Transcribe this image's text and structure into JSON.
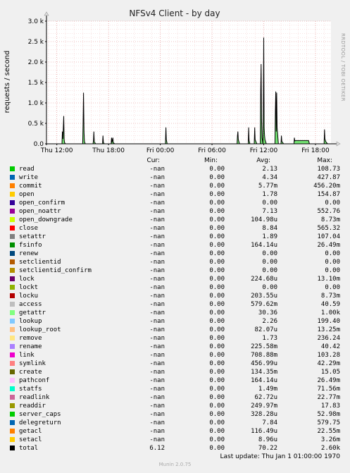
{
  "title": "NFSv4 Client - by day",
  "vertical_label": "requests / second",
  "right_text": "RRDTOOL / TOBI OETIKER",
  "footer": "Munin 2.0.75",
  "last_update": "Last update: Thu Jan  1 01:00:00 1970",
  "legend_headers": {
    "cur": "Cur:",
    "min": "Min:",
    "avg": "Avg:",
    "max": "Max:"
  },
  "legend": [
    {
      "name": "read",
      "color": "#00cc00",
      "cur": "-nan",
      "min": "0.00",
      "avg": "2.13",
      "max": "108.73"
    },
    {
      "name": "write",
      "color": "#0066b3",
      "cur": "-nan",
      "min": "0.00",
      "avg": "4.34",
      "max": "427.87"
    },
    {
      "name": "commit",
      "color": "#ff8000",
      "cur": "-nan",
      "min": "0.00",
      "avg": "5.77m",
      "max": "456.20m"
    },
    {
      "name": "open",
      "color": "#ffcc00",
      "cur": "-nan",
      "min": "0.00",
      "avg": "1.78",
      "max": "154.87"
    },
    {
      "name": "open_confirm",
      "color": "#330099",
      "cur": "-nan",
      "min": "0.00",
      "avg": "0.00",
      "max": "0.00"
    },
    {
      "name": "open_noattr",
      "color": "#990099",
      "cur": "-nan",
      "min": "0.00",
      "avg": "7.13",
      "max": "552.76"
    },
    {
      "name": "open_downgrade",
      "color": "#ccff00",
      "cur": "-nan",
      "min": "0.00",
      "avg": "104.98u",
      "max": "8.73m"
    },
    {
      "name": "close",
      "color": "#ff0000",
      "cur": "-nan",
      "min": "0.00",
      "avg": "8.84",
      "max": "565.32"
    },
    {
      "name": "setattr",
      "color": "#808080",
      "cur": "-nan",
      "min": "0.00",
      "avg": "1.89",
      "max": "107.04"
    },
    {
      "name": "fsinfo",
      "color": "#008f00",
      "cur": "-nan",
      "min": "0.00",
      "avg": "164.14u",
      "max": "26.49m"
    },
    {
      "name": "renew",
      "color": "#00487d",
      "cur": "-nan",
      "min": "0.00",
      "avg": "0.00",
      "max": "0.00"
    },
    {
      "name": "setclientid",
      "color": "#b35a00",
      "cur": "-nan",
      "min": "0.00",
      "avg": "0.00",
      "max": "0.00"
    },
    {
      "name": "setclientid_confirm",
      "color": "#b38f00",
      "cur": "-nan",
      "min": "0.00",
      "avg": "0.00",
      "max": "0.00"
    },
    {
      "name": "lock",
      "color": "#6b006b",
      "cur": "-nan",
      "min": "0.00",
      "avg": "224.68u",
      "max": "13.10m"
    },
    {
      "name": "lockt",
      "color": "#8fb300",
      "cur": "-nan",
      "min": "0.00",
      "avg": "0.00",
      "max": "0.00"
    },
    {
      "name": "locku",
      "color": "#b30000",
      "cur": "-nan",
      "min": "0.00",
      "avg": "203.55u",
      "max": "8.73m"
    },
    {
      "name": "access",
      "color": "#bebebe",
      "cur": "-nan",
      "min": "0.00",
      "avg": "579.62m",
      "max": "40.59"
    },
    {
      "name": "getattr",
      "color": "#80ff80",
      "cur": "-nan",
      "min": "0.00",
      "avg": "30.36",
      "max": "1.00k"
    },
    {
      "name": "lookup",
      "color": "#80c9ff",
      "cur": "-nan",
      "min": "0.00",
      "avg": "2.26",
      "max": "199.40"
    },
    {
      "name": "lookup_root",
      "color": "#ffc080",
      "cur": "-nan",
      "min": "0.00",
      "avg": "82.07u",
      "max": "13.25m"
    },
    {
      "name": "remove",
      "color": "#ffe680",
      "cur": "-nan",
      "min": "0.00",
      "avg": "1.73",
      "max": "236.24"
    },
    {
      "name": "rename",
      "color": "#aa80ff",
      "cur": "-nan",
      "min": "0.00",
      "avg": "225.58m",
      "max": "40.42"
    },
    {
      "name": "link",
      "color": "#ee00cc",
      "cur": "-nan",
      "min": "0.00",
      "avg": "708.88m",
      "max": "103.28"
    },
    {
      "name": "symlink",
      "color": "#ff8080",
      "cur": "-nan",
      "min": "0.00",
      "avg": "456.99u",
      "max": "42.29m"
    },
    {
      "name": "create",
      "color": "#666600",
      "cur": "-nan",
      "min": "0.00",
      "avg": "134.35m",
      "max": "15.05"
    },
    {
      "name": "pathconf",
      "color": "#ffbfff",
      "cur": "-nan",
      "min": "0.00",
      "avg": "164.14u",
      "max": "26.49m"
    },
    {
      "name": "statfs",
      "color": "#00ffcc",
      "cur": "-nan",
      "min": "0.00",
      "avg": "1.49m",
      "max": "71.56m"
    },
    {
      "name": "readlink",
      "color": "#cc6699",
      "cur": "-nan",
      "min": "0.00",
      "avg": "62.72u",
      "max": "22.77m"
    },
    {
      "name": "readdir",
      "color": "#999900",
      "cur": "-nan",
      "min": "0.00",
      "avg": "249.97m",
      "max": "17.83"
    },
    {
      "name": "server_caps",
      "color": "#00cc00",
      "cur": "-nan",
      "min": "0.00",
      "avg": "328.28u",
      "max": "52.98m"
    },
    {
      "name": "delegreturn",
      "color": "#0066b3",
      "cur": "-nan",
      "min": "0.00",
      "avg": "7.84",
      "max": "579.75"
    },
    {
      "name": "getacl",
      "color": "#ff8000",
      "cur": "-nan",
      "min": "0.00",
      "avg": "116.49u",
      "max": "22.55m"
    },
    {
      "name": "setacl",
      "color": "#ffcc00",
      "cur": "-nan",
      "min": "0.00",
      "avg": "8.96u",
      "max": "3.26m"
    },
    {
      "name": "total",
      "color": "#000000",
      "cur": "6.12",
      "min": "0.00",
      "avg": "70.22",
      "max": "2.60k"
    }
  ],
  "chart_data": {
    "type": "line",
    "title": "NFSv4 Client - by day",
    "ylabel": "requests / second",
    "xlabel": "",
    "ylim": [
      0,
      3000
    ],
    "x_range_hours": [
      10.8,
      19.4,
      43.8
    ],
    "x_ticks": [
      {
        "label": "Thu 12:00",
        "hour": 12
      },
      {
        "label": "Thu 18:00",
        "hour": 18
      },
      {
        "label": "Fri 00:00",
        "hour": 24
      },
      {
        "label": "Fri 06:00",
        "hour": 30
      },
      {
        "label": "Fri 12:00",
        "hour": 36
      },
      {
        "label": "Fri 18:00",
        "hour": 42
      }
    ],
    "y_ticks": [
      {
        "label": "0.0",
        "value": 0
      },
      {
        "label": "0.5 k",
        "value": 500
      },
      {
        "label": "1.0 k",
        "value": 1000
      },
      {
        "label": "1.5 k",
        "value": 1500
      },
      {
        "label": "2.0 k",
        "value": 2000
      },
      {
        "label": "2.5 k",
        "value": 2500
      },
      {
        "label": "3.0 k",
        "value": 3000
      }
    ],
    "grid": true,
    "series": [
      {
        "name": "total",
        "color": "#000000",
        "points": [
          [
            12.6,
            0
          ],
          [
            12.65,
            300
          ],
          [
            12.7,
            120
          ],
          [
            12.75,
            400
          ],
          [
            12.8,
            680
          ],
          [
            12.85,
            100
          ],
          [
            12.9,
            30
          ],
          [
            13.0,
            0
          ],
          [
            15.0,
            0
          ],
          [
            15.05,
            500
          ],
          [
            15.1,
            1250
          ],
          [
            15.15,
            300
          ],
          [
            15.2,
            60
          ],
          [
            15.3,
            0
          ],
          [
            16.2,
            0
          ],
          [
            16.25,
            80
          ],
          [
            16.3,
            300
          ],
          [
            16.35,
            50
          ],
          [
            16.5,
            0
          ],
          [
            17.3,
            0
          ],
          [
            17.35,
            200
          ],
          [
            17.4,
            40
          ],
          [
            17.5,
            0
          ],
          [
            18.3,
            0
          ],
          [
            18.35,
            150
          ],
          [
            18.4,
            30
          ],
          [
            18.5,
            150
          ],
          [
            18.55,
            30
          ],
          [
            18.7,
            0
          ],
          [
            24.6,
            0
          ],
          [
            24.65,
            400
          ],
          [
            24.7,
            100
          ],
          [
            24.8,
            0
          ],
          [
            32.9,
            0
          ],
          [
            32.95,
            200
          ],
          [
            33.0,
            300
          ],
          [
            33.05,
            100
          ],
          [
            33.2,
            0
          ],
          [
            34.2,
            0
          ],
          [
            34.25,
            400
          ],
          [
            34.3,
            80
          ],
          [
            34.4,
            0
          ],
          [
            34.9,
            0
          ],
          [
            34.95,
            400
          ],
          [
            35.0,
            100
          ],
          [
            35.2,
            0
          ],
          [
            35.6,
            0
          ],
          [
            35.65,
            1300
          ],
          [
            35.7,
            1950
          ],
          [
            35.75,
            600
          ],
          [
            35.8,
            150
          ],
          [
            35.9,
            0
          ],
          [
            35.95,
            800
          ],
          [
            36.0,
            2600
          ],
          [
            36.05,
            400
          ],
          [
            36.1,
            200
          ],
          [
            36.15,
            100
          ],
          [
            36.3,
            0
          ],
          [
            37.3,
            0
          ],
          [
            37.35,
            800
          ],
          [
            37.4,
            1280
          ],
          [
            37.45,
            300
          ],
          [
            37.5,
            1250
          ],
          [
            37.55,
            400
          ],
          [
            37.7,
            0
          ],
          [
            38.0,
            0
          ],
          [
            38.05,
            200
          ],
          [
            38.1,
            60
          ],
          [
            38.3,
            0
          ],
          [
            39.5,
            0
          ],
          [
            39.55,
            150
          ],
          [
            39.6,
            70
          ],
          [
            39.7,
            80
          ],
          [
            41.2,
            80
          ],
          [
            41.3,
            0
          ],
          [
            43.0,
            0
          ],
          [
            43.05,
            350
          ],
          [
            43.1,
            120
          ],
          [
            43.2,
            50
          ],
          [
            43.4,
            0
          ]
        ]
      }
    ]
  }
}
